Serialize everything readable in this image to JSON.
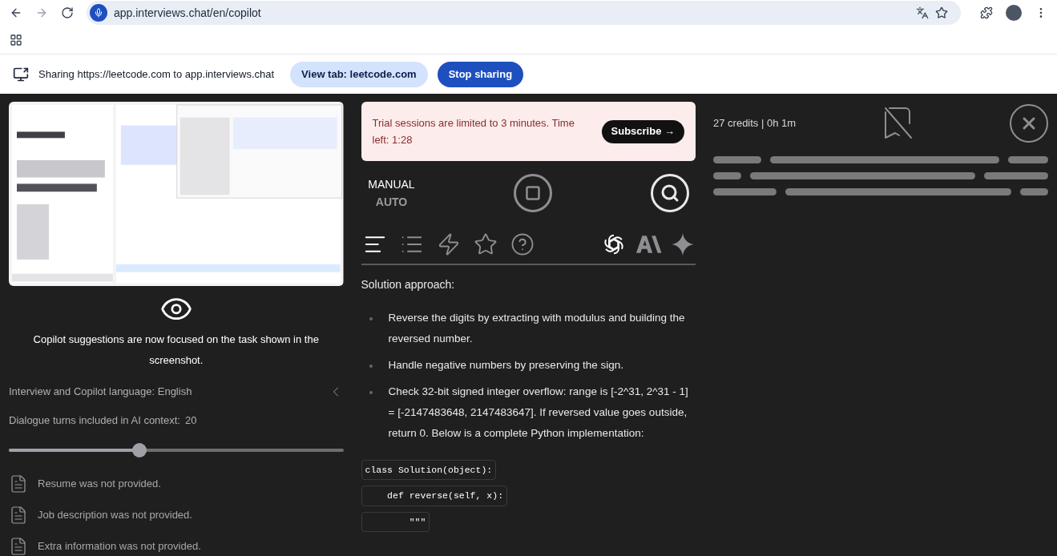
{
  "browser": {
    "url": "app.interviews.chat/en/copilot"
  },
  "sharing_bar": {
    "message": "Sharing https://leetcode.com to app.interviews.chat",
    "buttons": [
      {
        "label": "View tab: leetcode.com",
        "kind": "secondary"
      },
      {
        "label": "Stop sharing",
        "kind": "primary"
      }
    ]
  },
  "left_panel": {
    "focus_message": "Copilot suggestions are now focused on the task shown in the screenshot.",
    "language": "Interview and Copilot language: English",
    "context_label": "Dialogue turns included in AI context:",
    "context_value": "20",
    "context_slider": {
      "level": 0.39
    },
    "documents": [
      {
        "text": "Resume was not provided."
      },
      {
        "text": "Job description was not provided."
      },
      {
        "text": "Extra information was not provided."
      }
    ]
  },
  "trial_banner": {
    "message": "Trial sessions are limited to 3 minutes. Time left: 1:28",
    "button": "Subscribe →"
  },
  "modes": [
    {
      "label": "MANUAL",
      "selected": true
    },
    {
      "label": "AUTO",
      "selected": false
    }
  ],
  "view_tabs": [
    {
      "kind": "text",
      "selected": true
    },
    {
      "kind": "list",
      "selected": false
    },
    {
      "kind": "bolt",
      "selected": false
    },
    {
      "kind": "star",
      "selected": false
    },
    {
      "kind": "help",
      "selected": false
    }
  ],
  "models": [
    {
      "kind": "openai",
      "selected": true
    },
    {
      "kind": "anthropic",
      "selected": false
    },
    {
      "kind": "gemini",
      "selected": false
    }
  ],
  "answer": {
    "heading": "Solution approach:",
    "bullets": [
      "Reverse the digits by extracting with modulus and building the reversed number.",
      "Handle negative numbers by preserving the sign.",
      "Check 32-bit signed integer overflow: range is [-2^31, 2^31 - 1] = [-2147483648, 2147483647]. If reversed value goes outside, return 0. Below is a complete Python implementation:"
    ],
    "code_lines": [
      "class Solution(object):",
      "    def reverse(self, x):",
      "        \"\"\""
    ]
  },
  "status": {
    "credits": "27 credits | 0h 1m"
  }
}
